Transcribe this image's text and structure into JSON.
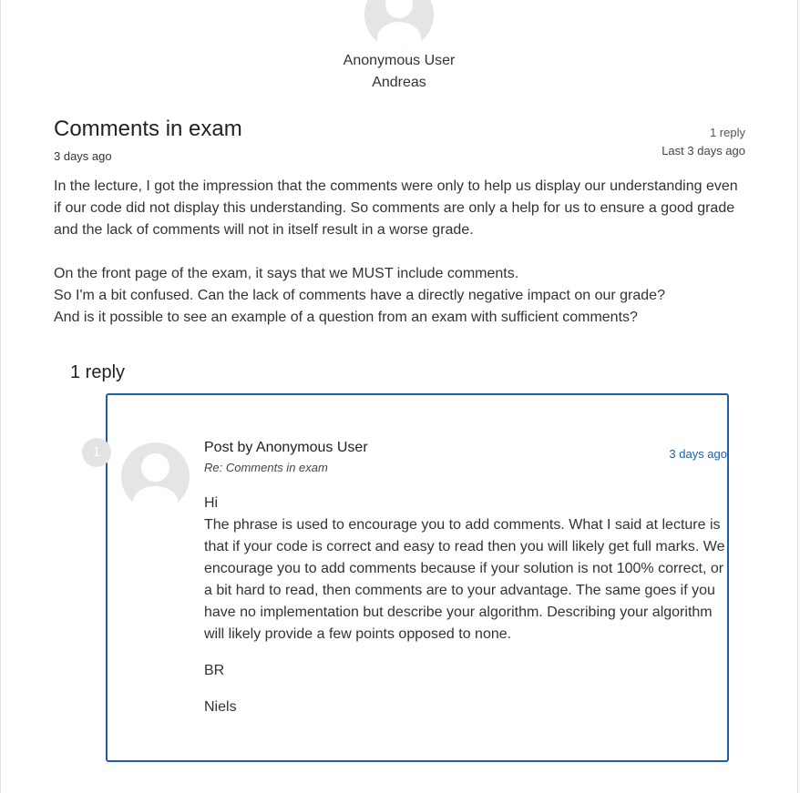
{
  "author": {
    "name": "Anonymous User",
    "subtitle": "Andreas",
    "avatar_icon": "user-avatar-icon"
  },
  "thread": {
    "title": "Comments in exam",
    "posted": "3 days ago",
    "reply_count": "1 reply",
    "last_activity": "Last 3 days ago",
    "paragraph1": "In the lecture, I got the impression that the comments were only to help us display our understanding even if our code did not display this understanding. So comments are only a help for us to ensure a good grade and the lack of comments will not in itself result in a worse grade.",
    "paragraph2_line1": "On the front page of the exam, it says that we MUST include comments.",
    "paragraph2_line2": "So I'm a bit confused. Can the lack of comments have a directly negative impact on our grade?",
    "paragraph2_line3": "And is it possible to see an example of a question from an exam with sufficient comments?"
  },
  "replies": {
    "heading": "1 reply",
    "items": [
      {
        "number": "1",
        "author": "Post by Anonymous User",
        "subject": "Re: Comments in exam",
        "date": "3 days ago",
        "greeting": "Hi",
        "body": "The phrase is used to encourage you to add comments. What I said at lecture is that if your code is correct and easy to read then you will likely get full marks. We encourage you to add comments because if your solution is not 100% cor­rect, or a bit hard to read, then comments are to your advantage. The same goes if you have no implementation but describe your algorithm. Describing your algorithm will likely provide a few points opposed to none.",
        "closing": "BR",
        "signature": "Niels"
      }
    ]
  },
  "colors": {
    "accent": "#1f5fa8",
    "text": "#333333",
    "avatar_bg": "#e5e5e5"
  }
}
